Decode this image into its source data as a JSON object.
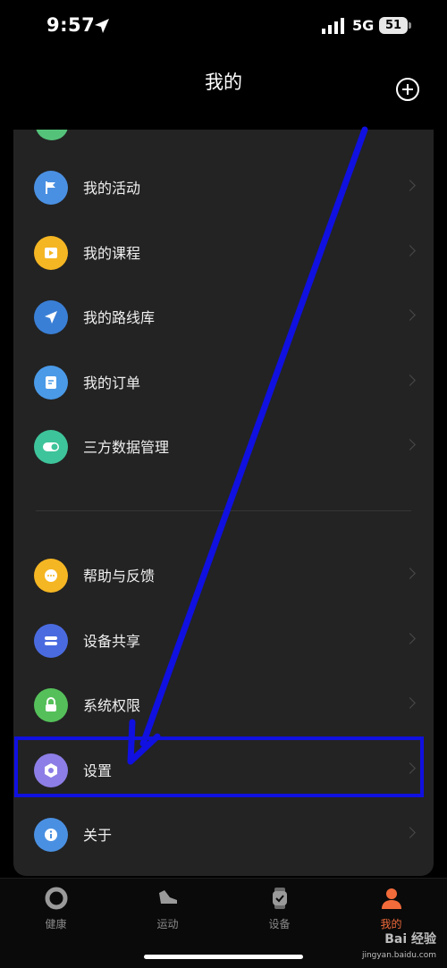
{
  "status_bar": {
    "time": "9:57",
    "network": "5G",
    "battery": "51"
  },
  "header": {
    "title": "我的"
  },
  "menu_group_1": [
    {
      "label": "我的活动",
      "icon": "flag-icon",
      "color": "#4a90e2"
    },
    {
      "label": "我的课程",
      "icon": "play-icon",
      "color": "#f5b623"
    },
    {
      "label": "我的路线库",
      "icon": "navigation-icon",
      "color": "#3a7fd6"
    },
    {
      "label": "我的订单",
      "icon": "document-icon",
      "color": "#4a9ae8"
    },
    {
      "label": "三方数据管理",
      "icon": "toggle-icon",
      "color": "#3ec49a"
    }
  ],
  "menu_group_2": [
    {
      "label": "帮助与反馈",
      "icon": "chat-icon",
      "color": "#f5b623"
    },
    {
      "label": "设备共享",
      "icon": "share-icon",
      "color": "#4a6be0"
    },
    {
      "label": "系统权限",
      "icon": "lock-icon",
      "color": "#55c05a"
    },
    {
      "label": "设置",
      "icon": "settings-icon",
      "color": "#8c7ee6"
    },
    {
      "label": "关于",
      "icon": "info-icon",
      "color": "#4a90e2"
    }
  ],
  "tabs": [
    {
      "label": "健康",
      "icon": "ring-icon",
      "active": false
    },
    {
      "label": "运动",
      "icon": "shoe-icon",
      "active": false
    },
    {
      "label": "设备",
      "icon": "watch-icon",
      "active": false
    },
    {
      "label": "我的",
      "icon": "person-icon",
      "active": true
    }
  ],
  "watermark": {
    "text": "Bai 经验",
    "sub": "jingyan.baidu.com"
  },
  "colors": {
    "active_tab": "#f26b3a",
    "highlight_box": "#1010e0",
    "arrow": "#1010e0"
  }
}
